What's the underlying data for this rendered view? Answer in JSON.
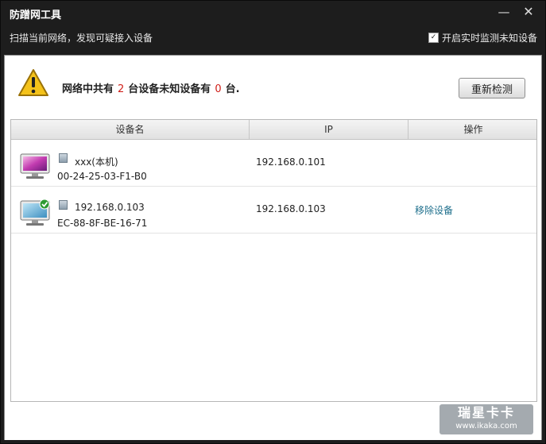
{
  "window": {
    "title": "防蹭网工具",
    "minimize_symbol": "—",
    "close_symbol": "✕"
  },
  "subbar": {
    "description": "扫描当前网络，发现可疑接入设备",
    "monitor_label": "开启实时监测未知设备",
    "monitor_checked": true
  },
  "summary": {
    "prefix": "网络中共有",
    "total": "2",
    "middle": "台设备未知设备有",
    "unknown": "0",
    "suffix": "台."
  },
  "recheck_label": "重新检测",
  "table": {
    "headers": [
      "设备名",
      "IP",
      "操作"
    ],
    "rows": [
      {
        "name": "xxx(本机)",
        "mac": "00-24-25-03-F1-B0",
        "ip": "192.168.0.101",
        "action": "",
        "icon": "computer-icon"
      },
      {
        "name": "192.168.0.103",
        "mac": "EC-88-8F-BE-16-71",
        "ip": "192.168.0.103",
        "action": "移除设备",
        "icon": "trusted-monitor-icon"
      }
    ]
  },
  "watermark": {
    "brand": "瑞星卡卡",
    "url": "www.ikaka.com"
  }
}
